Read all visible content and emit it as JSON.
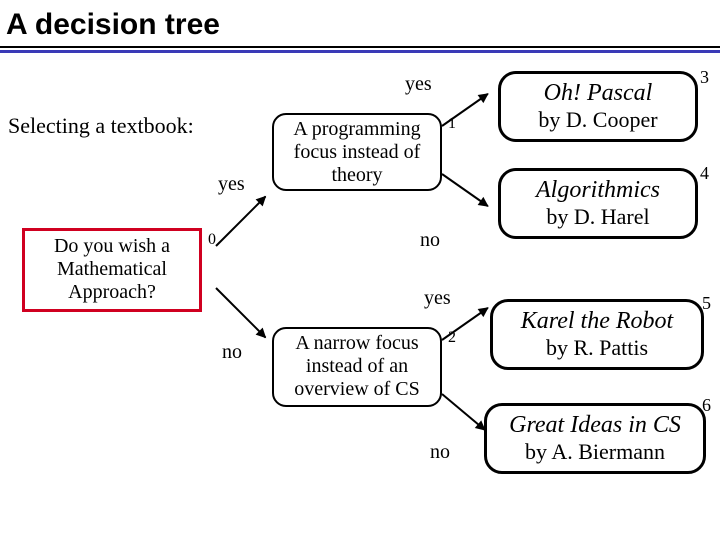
{
  "title": "A decision tree",
  "subtitle": "Selecting a textbook:",
  "labels": {
    "yes_top": "yes",
    "yes_mid": "yes",
    "no_from1": "no",
    "no_branch": "no",
    "yes_bot": "yes",
    "no_bot": "no"
  },
  "nodes": {
    "n0": {
      "text": "Do you wish a Mathematical Approach?",
      "num": "0"
    },
    "n1": {
      "text": "A programming focus instead of theory",
      "num": "1"
    },
    "n2": {
      "text": "A narrow focus instead of an overview of CS",
      "num": "2"
    }
  },
  "books": {
    "b3": {
      "title": "Oh! Pascal",
      "author": "by D. Cooper",
      "num": "3"
    },
    "b4": {
      "title": "Algorithmics",
      "author": "by D. Harel",
      "num": "4"
    },
    "b5": {
      "title": "Karel the Robot",
      "author": "by R. Pattis",
      "num": "5"
    },
    "b6": {
      "title": "Great Ideas in CS",
      "author": "by A. Biermann",
      "num": "6"
    }
  }
}
